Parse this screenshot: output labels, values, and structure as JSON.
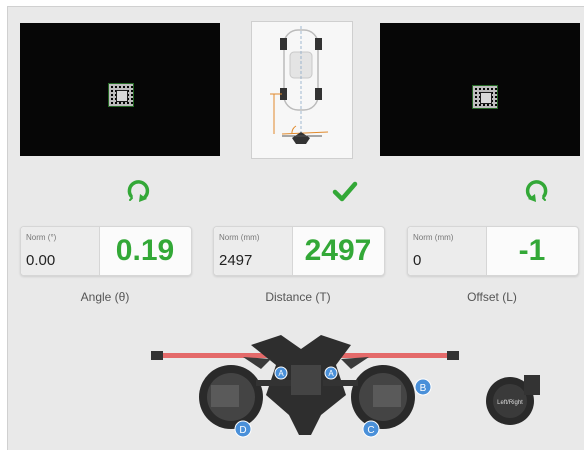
{
  "cameras": {
    "left": {
      "name": "left-camera-view"
    },
    "right": {
      "name": "right-camera-view"
    }
  },
  "diagram": {
    "name": "vehicle-top-view-diagram"
  },
  "indicators": {
    "angle": {
      "icon": "rotate-clockwise-icon",
      "color": "#33a837"
    },
    "distance": {
      "icon": "checkmark-icon",
      "color": "#33a837"
    },
    "offset": {
      "icon": "rotate-counterclockwise-icon",
      "color": "#33a837"
    }
  },
  "measurements": [
    {
      "norm_label": "Norm (°)",
      "norm_value": "0.00",
      "value": "0.19",
      "caption": "Angle (θ)"
    },
    {
      "norm_label": "Norm (mm)",
      "norm_value": "2497",
      "value": "2497",
      "caption": "Distance (T)"
    },
    {
      "norm_label": "Norm (mm)",
      "norm_value": "0",
      "value": "-1",
      "caption": "Offset (L)"
    }
  ],
  "fixture": {
    "markers": [
      "A",
      "B",
      "C",
      "D"
    ],
    "clamp_label": "Left/Right",
    "marker_color": "#4a90d9",
    "bar_color": "#e46a6a"
  },
  "colors": {
    "accent": "#33a837",
    "background": "#e9e9e9"
  }
}
